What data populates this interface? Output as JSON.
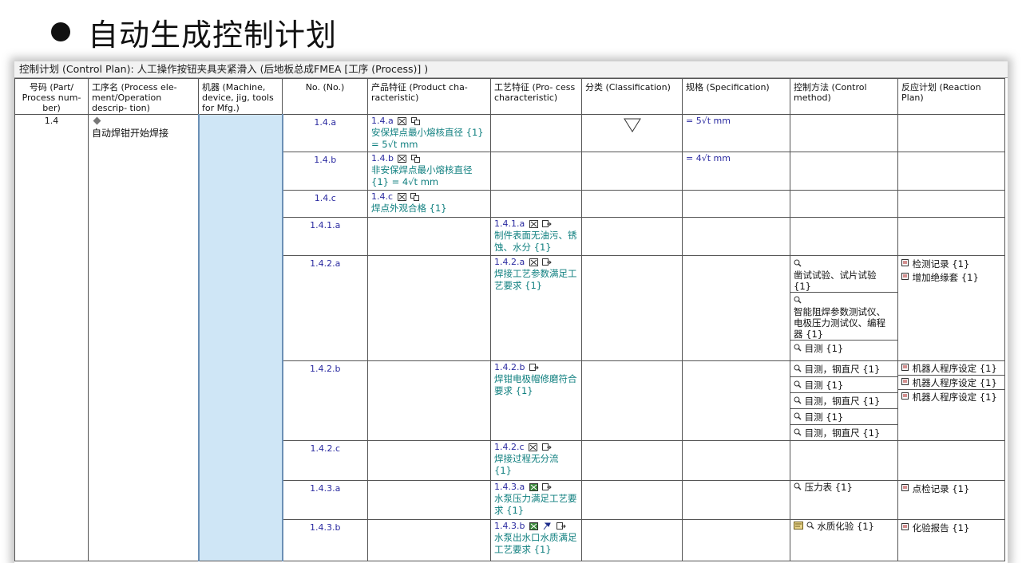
{
  "slide": {
    "title": "自动生成控制计划"
  },
  "window": {
    "title": "控制计划 (Control Plan): 人工操作按钮夹具夹紧滑入 (后地板总成FMEA [工序 (Process)] )"
  },
  "columns": [
    "号码 (Part/ Process num- ber)",
    "工序名 (Process ele- ment/Operation descrip- tion)",
    "机器 (Machine, device, jig, tools for Mfg.)",
    "No. (No.)",
    "产品特征 (Product cha- racteristic)",
    "工艺特征 (Pro- cess characteristic)",
    "分类 (Classification)",
    "规格 (Specification)",
    "控制方法 (Control method)",
    "反应计划 (Reaction Plan)"
  ],
  "process": {
    "number": "1.4",
    "name": "自动焊钳开始焊接"
  },
  "rows": [
    {
      "no": "1.4.a",
      "product_code": "1.4.a",
      "product_text": "安保焊点最小熔核直径 {1} = 5√t mm",
      "process_code": "",
      "process_text": "",
      "classification": "triangle-down",
      "spec": "= 5√t mm",
      "control": [],
      "reaction": []
    },
    {
      "no": "1.4.b",
      "product_code": "1.4.b",
      "product_text": "非安保焊点最小熔核直径 {1} = 4√t mm",
      "process_code": "",
      "process_text": "",
      "classification": "",
      "spec": "= 4√t mm",
      "control": [],
      "reaction": []
    },
    {
      "no": "1.4.c",
      "product_code": "1.4.c",
      "product_text": "焊点外观合格 {1}",
      "process_code": "",
      "process_text": "",
      "classification": "",
      "spec": "",
      "control": [],
      "reaction": []
    },
    {
      "no": "1.4.1.a",
      "product_code": "",
      "product_text": "",
      "process_code": "1.4.1.a",
      "process_text": "制件表面无油污、锈蚀、水分 {1}",
      "classification": "",
      "spec": "",
      "control": [],
      "reaction": []
    },
    {
      "no": "1.4.2.a",
      "product_code": "",
      "product_text": "",
      "process_code": "1.4.2.a",
      "process_text": "焊接工艺参数满足工艺要求 {1}",
      "classification": "",
      "spec": "",
      "control": [
        "凿试试验、试片试验 {1}",
        "智能阻焊参数测试仪、电极压力测试仪、编程器 {1}",
        "目测 {1}"
      ],
      "reaction": [
        "检测记录 {1}",
        "增加绝缘套 {1}"
      ]
    },
    {
      "no": "1.4.2.b",
      "product_code": "",
      "product_text": "",
      "process_code": "1.4.2.b",
      "process_text": "焊钳电极帽修磨符合要求 {1}",
      "classification": "",
      "spec": "",
      "control": [
        "目测，钢直尺 {1}",
        "目测 {1}",
        "目测，钢直尺 {1}",
        "目测 {1}",
        "目测，钢直尺 {1}"
      ],
      "reaction": [
        "机器人程序设定 {1}",
        "机器人程序设定 {1}",
        "机器人程序设定 {1}"
      ]
    },
    {
      "no": "1.4.2.c",
      "product_code": "",
      "product_text": "",
      "process_code": "1.4.2.c",
      "process_text": "焊接过程无分流 {1}",
      "classification": "",
      "spec": "",
      "control": [],
      "reaction": []
    },
    {
      "no": "1.4.3.a",
      "product_code": "",
      "product_text": "",
      "process_code": "1.4.3.a",
      "process_text": "水泵压力满足工艺要求 {1}",
      "classification": "",
      "spec": "",
      "control": [
        "压力表 {1}"
      ],
      "reaction": [
        "点检记录 {1}"
      ]
    },
    {
      "no": "1.4.3.b",
      "product_code": "",
      "product_text": "",
      "process_code": "1.4.3.b",
      "process_text": "水泵出水口水质满足工艺要求 {1}",
      "classification": "",
      "spec": "",
      "control": [
        "水质化验 {1}"
      ],
      "reaction": [
        "化验报告 {1}"
      ]
    }
  ],
  "icons": {
    "characteristic": "grid-icon",
    "link": "link-icon",
    "control": "magnifier-icon",
    "reaction": "reaction-box-icon",
    "classification": "triangle-down-icon"
  },
  "colors": {
    "machine_column": "#cfe6f6",
    "code_text": "#2a2aa0",
    "characteristic_text": "#0f7f7f"
  }
}
